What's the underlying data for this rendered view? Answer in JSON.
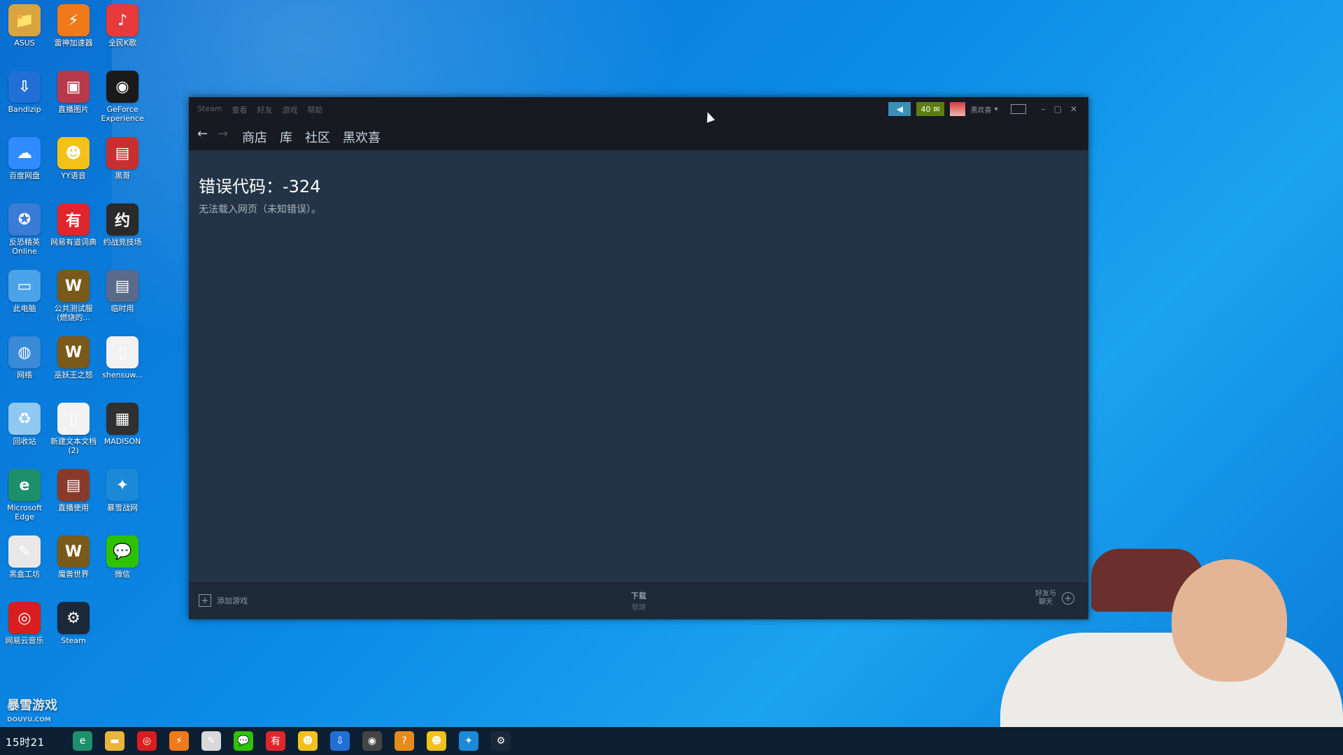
{
  "desktop": {
    "icons": [
      {
        "label": "ASUS",
        "glyph": "📁",
        "color": "#d9a440"
      },
      {
        "label": "雷神加速器",
        "glyph": "⚡",
        "color": "#f07a1a"
      },
      {
        "label": "全民K歌",
        "glyph": "♪",
        "color": "#e83a3a"
      },
      {
        "label": "Bandizip",
        "glyph": "⇩",
        "color": "#1f6fd6"
      },
      {
        "label": "直播图片",
        "glyph": "▣",
        "color": "#b83a4a"
      },
      {
        "label": "GeForce Experience",
        "glyph": "◉",
        "color": "#1a1a1a"
      },
      {
        "label": "百度网盘",
        "glyph": "☁",
        "color": "#2f8cff"
      },
      {
        "label": "YY语音",
        "glyph": "☻",
        "color": "#f2c21a"
      },
      {
        "label": "黑哥",
        "glyph": "▤",
        "color": "#c83030"
      },
      {
        "label": "反恐精英Online",
        "glyph": "✪",
        "color": "#3a7bd5"
      },
      {
        "label": "网易有道词典",
        "glyph": "有",
        "color": "#e0262c"
      },
      {
        "label": "约战竞技场",
        "glyph": "约",
        "color": "#2a2a2a"
      },
      {
        "label": "此电脑",
        "glyph": "▭",
        "color": "#4aa3e8"
      },
      {
        "label": "公共测试服(燃烧的...",
        "glyph": "W",
        "color": "#7a5a1a"
      },
      {
        "label": "临时用",
        "glyph": "▤",
        "color": "#5a6a8a"
      },
      {
        "label": "网络",
        "glyph": "◍",
        "color": "#3a8ad8"
      },
      {
        "label": "巫妖王之怒",
        "glyph": "W",
        "color": "#7a5a1a"
      },
      {
        "label": "shensuw...",
        "glyph": "▯",
        "color": "#f2f2f2"
      },
      {
        "label": "回收站",
        "glyph": "♻",
        "color": "#8fc8f0"
      },
      {
        "label": "新建文本文档 (2)",
        "glyph": "▯",
        "color": "#f2f2f2"
      },
      {
        "label": "MADISON",
        "glyph": "▦",
        "color": "#303030"
      },
      {
        "label": "Microsoft Edge",
        "glyph": "e",
        "color": "#1d8f6a"
      },
      {
        "label": "直播使用",
        "glyph": "▤",
        "color": "#8a3a2a"
      },
      {
        "label": "暴雪战网",
        "glyph": "✦",
        "color": "#1a8ad8"
      },
      {
        "label": "黑盒工坊",
        "glyph": "✎",
        "color": "#e8e8e8"
      },
      {
        "label": "魔兽世界",
        "glyph": "W",
        "color": "#7a5a1a"
      },
      {
        "label": "微信",
        "glyph": "💬",
        "color": "#2dc100"
      },
      {
        "label": "网易云音乐",
        "glyph": "◎",
        "color": "#d81e1e"
      },
      {
        "label": "Steam",
        "glyph": "⚙",
        "color": "#1b2838"
      }
    ]
  },
  "steam": {
    "menu": [
      "Steam",
      "查看",
      "好友",
      "游戏",
      "帮助"
    ],
    "notif_count": "40",
    "username": "黑欢喜",
    "nav": {
      "back": "←",
      "forward": "→",
      "links": [
        "商店",
        "库",
        "社区",
        "黑欢喜"
      ]
    },
    "error": {
      "title": "错误代码：-324",
      "message": "无法载入网页（未知错误）。"
    },
    "bottom": {
      "add_game": "添加游戏",
      "downloads_title": "下载",
      "downloads_sub": "管理",
      "friends_line1": "好友与",
      "friends_line2": "聊天"
    }
  },
  "overlay": {
    "watermark_main": "暴雪游戏",
    "watermark_sub": "DOUYU.COM"
  },
  "taskbar": {
    "clock": "15时21",
    "apps": [
      {
        "glyph": "e",
        "color": "#1d8f6a"
      },
      {
        "glyph": "▬",
        "color": "#e8b43a"
      },
      {
        "glyph": "◎",
        "color": "#d81e1e"
      },
      {
        "glyph": "⚡",
        "color": "#f07a1a"
      },
      {
        "glyph": "✎",
        "color": "#d8d8d8"
      },
      {
        "glyph": "💬",
        "color": "#2dc100"
      },
      {
        "glyph": "有",
        "color": "#e0262c"
      },
      {
        "glyph": "☻",
        "color": "#f2c21a"
      },
      {
        "glyph": "⇩",
        "color": "#1f6fd6"
      },
      {
        "glyph": "◉",
        "color": "#444444"
      },
      {
        "glyph": "?",
        "color": "#e88a1a"
      },
      {
        "glyph": "☻",
        "color": "#f2c21a"
      },
      {
        "glyph": "✦",
        "color": "#1a8ad8"
      },
      {
        "glyph": "⚙",
        "color": "#1b2838"
      }
    ]
  }
}
